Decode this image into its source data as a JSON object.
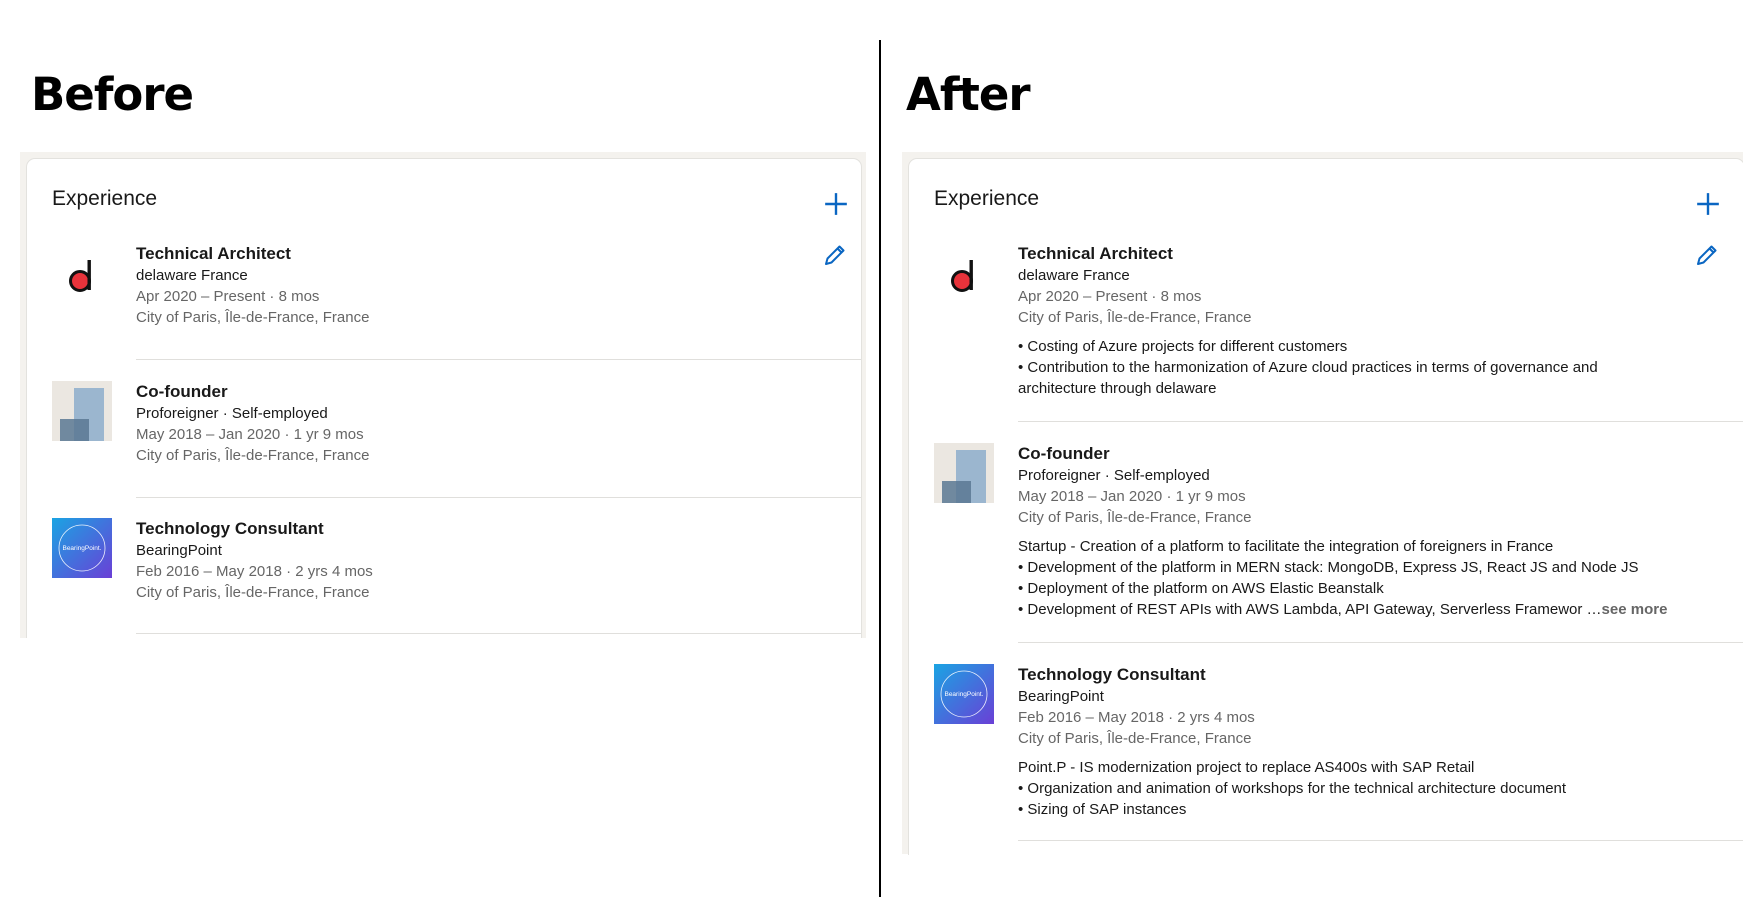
{
  "labels": {
    "before": "Before",
    "after": "After"
  },
  "card": {
    "title": "Experience"
  },
  "colors": {
    "accent": "#0a66c2",
    "panel": "#f4f2ee",
    "delaware_red": "#e8333b",
    "bearingpoint_start": "#1aa4e3",
    "bearingpoint_end": "#6a3fd6"
  },
  "icons": {
    "add": "plus-icon",
    "edit": "pencil-icon"
  },
  "experience": [
    {
      "role": "Technical Architect",
      "company": "delaware France",
      "dates": "Apr 2020 – Present · 8 mos",
      "location": "City of Paris, Île-de-France, France",
      "description": [
        "• Costing of Azure projects for different customers",
        "• Contribution to the harmonization of Azure cloud practices in terms of governance and",
        "architecture through delaware"
      ]
    },
    {
      "role": "Co-founder",
      "company": "Proforeigner · Self-employed",
      "dates": "May 2018 – Jan 2020 · 1 yr 9 mos",
      "location": "City of Paris, Île-de-France, France",
      "description": [
        "Startup - Creation of a platform to facilitate the integration of foreigners in France",
        "• Development of the platform in MERN stack: MongoDB, Express JS, React JS and Node JS",
        "• Deployment of the platform on AWS Elastic Beanstalk",
        "• Development of REST APIs with AWS Lambda, API Gateway, Serverless Framewor …"
      ],
      "see_more": "see more"
    },
    {
      "role": "Technology Consultant",
      "company": "BearingPoint",
      "dates": "Feb 2016 – May 2018 · 2 yrs 4 mos",
      "location": "City of Paris, Île-de-France, France",
      "logo_text": "BearingPoint.",
      "description": [
        "Point.P - IS modernization project to replace AS400s with SAP Retail",
        "• Organization and animation of workshops for the technical architecture document",
        "• Sizing of SAP instances"
      ]
    }
  ]
}
